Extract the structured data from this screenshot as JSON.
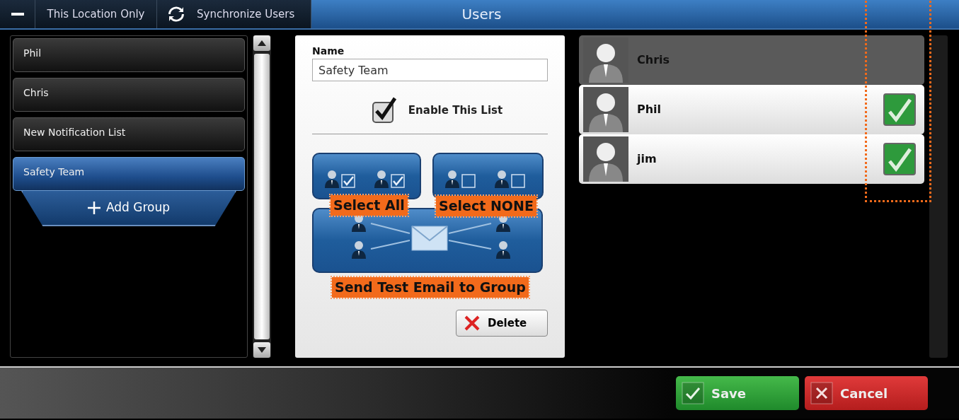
{
  "toolbar": {
    "location_button": "This Location Only",
    "sync_button": "Synchronize Users",
    "title": "Users"
  },
  "groups": [
    {
      "label": "Phil",
      "selected": false
    },
    {
      "label": "Chris",
      "selected": false
    },
    {
      "label": "New Notification List",
      "selected": false
    },
    {
      "label": "Safety Team",
      "selected": true
    }
  ],
  "add_group": "Add Group",
  "editor": {
    "name_label": "Name",
    "name_value": "Safety Team",
    "enable": {
      "label": "Enable This List",
      "checked": true
    },
    "select_all": "Select All",
    "select_none": "Select NONE",
    "send_test": "Send Test Email to Group",
    "delete": "Delete"
  },
  "users": [
    {
      "name": "Chris",
      "checked": false
    },
    {
      "name": "Phil",
      "checked": true
    },
    {
      "name": "jim",
      "checked": true
    }
  ],
  "footer_buttons": [
    {
      "kind": "save",
      "label": "Save"
    },
    {
      "kind": "cancel",
      "label": "Cancel"
    }
  ]
}
